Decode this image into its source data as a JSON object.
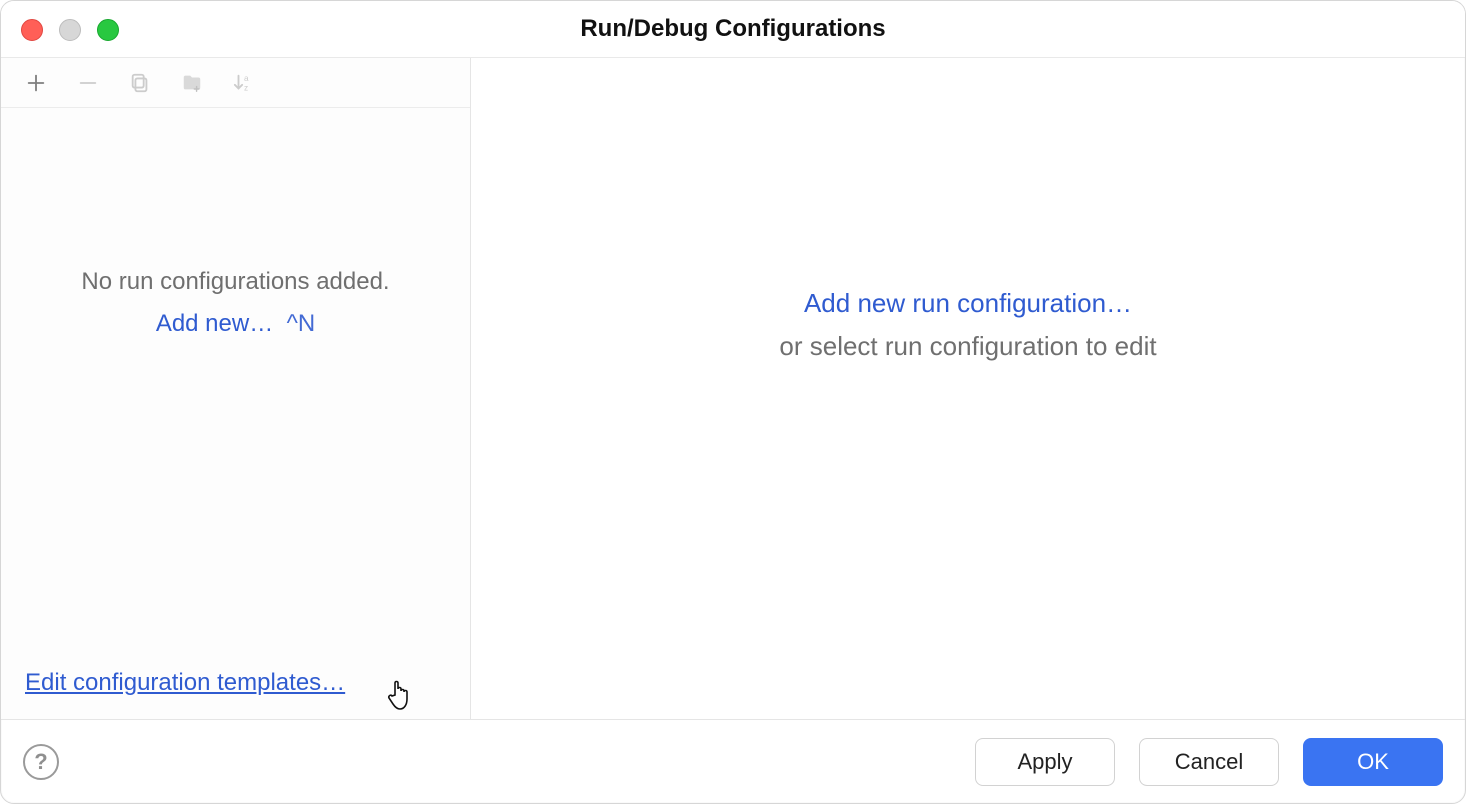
{
  "window": {
    "title": "Run/Debug Configurations"
  },
  "toolbar_icons": {
    "add": "plus-icon",
    "remove": "minus-icon",
    "copy": "copy-icon",
    "folder": "folder-icon",
    "sort": "sort-az-icon"
  },
  "sidebar": {
    "empty_text": "No run configurations added.",
    "add_new_label": "Add new…",
    "add_new_shortcut": "^N",
    "edit_templates_link": "Edit configuration templates…"
  },
  "content": {
    "add_new_label": "Add new run configuration…",
    "or_select_text": "or select run configuration to edit"
  },
  "buttons": {
    "help": "?",
    "apply": "Apply",
    "cancel": "Cancel",
    "ok": "OK"
  }
}
